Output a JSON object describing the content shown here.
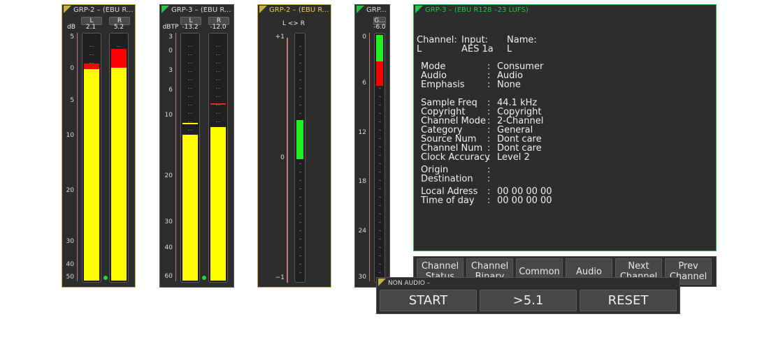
{
  "meter1": {
    "title": "GRP-2 – (EBU R...",
    "unit": "dB",
    "channels": [
      {
        "label": "L",
        "value": "2.1"
      },
      {
        "label": "R",
        "value": "5.2"
      }
    ],
    "scale": [
      "5",
      "0",
      "5",
      "10",
      "20",
      "30",
      "40",
      "50"
    ]
  },
  "meter2": {
    "title": "GRP-3 – (EBU R...",
    "unit": "dBTP",
    "channels": [
      {
        "label": "L",
        "value": "-13.2"
      },
      {
        "label": "R",
        "value": "-12.0"
      }
    ],
    "scale": [
      "3",
      "0",
      "3",
      "6",
      "10",
      "20",
      "30",
      "40",
      "60"
    ]
  },
  "meter3": {
    "title": "GRP-2 – (EBU R...",
    "header": "L <> R",
    "scale": [
      "+1",
      "0",
      "−1"
    ]
  },
  "meter4": {
    "title": "GRP...",
    "channel": "G...",
    "value": "-6.0",
    "scale": [
      "0",
      "6",
      "12",
      "18",
      "24",
      "30"
    ]
  },
  "status": {
    "title": "GRP-3 – (EBU R128 –23 LUFS)",
    "header": {
      "channel_label": "Channel:",
      "channel_value": "L",
      "input_label": "Input:",
      "input_value": "AES 1a",
      "name_label": "Name:",
      "name_value": "L"
    },
    "rows": [
      {
        "label": "Mode",
        "value": "Consumer"
      },
      {
        "label": "Audio",
        "value": "Audio"
      },
      {
        "label": "Emphasis",
        "value": "None"
      },
      {
        "label": "Sample Freq",
        "value": "44.1 kHz"
      },
      {
        "label": "Copyright",
        "value": "Copyright"
      },
      {
        "label": "Channel Mode",
        "value": "2-Channel"
      },
      {
        "label": "Category",
        "value": "General"
      },
      {
        "label": "Source Num",
        "value": "Dont care"
      },
      {
        "label": "Channel Num",
        "value": "Dont care"
      },
      {
        "label": "Clock Accuracy",
        "value": "Level 2"
      },
      {
        "label": "Origin",
        "value": ""
      },
      {
        "label": "Destination",
        "value": ""
      },
      {
        "label": "Local Adress",
        "value": "00 00 00 00"
      },
      {
        "label": "Time of day",
        "value": "00 00 00 00"
      }
    ],
    "buttons": [
      {
        "line1": "Channel",
        "line2": "Status"
      },
      {
        "line1": "Channel",
        "line2": "Binary"
      },
      {
        "line1": "Common",
        "line2": ""
      },
      {
        "line1": "Audio",
        "line2": ""
      },
      {
        "line1": "Next",
        "line2": "Channel"
      },
      {
        "line1": "Prev",
        "line2": "Channel"
      }
    ]
  },
  "nonaudio": {
    "title": "NON AUDIO –",
    "buttons": [
      "START",
      ">5.1",
      "RESET"
    ]
  },
  "colors": {
    "accent_yellow": "#c9b040",
    "accent_green": "#2bc24a",
    "meter_fill": "#ffff00",
    "peak": "#ff0000"
  }
}
